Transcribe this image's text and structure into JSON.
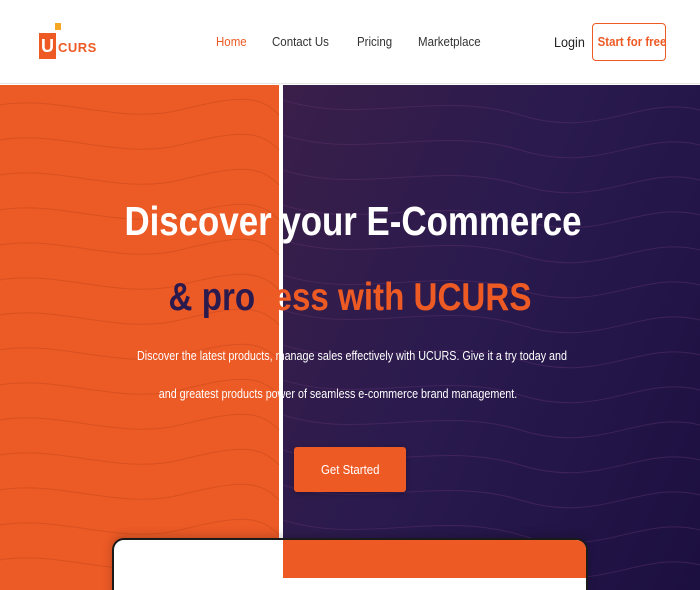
{
  "brand": {
    "logo_letter": "U",
    "logo_text": "CURS",
    "accent_color": "#ee5a24"
  },
  "nav": {
    "links": [
      {
        "label": "Home",
        "active": true
      },
      {
        "label": "Contact Us",
        "active": false
      },
      {
        "label": "Pricing",
        "active": false
      },
      {
        "label": "Marketplace",
        "active": false
      }
    ],
    "login_label": "Login",
    "start_label": "Start for free"
  },
  "hero": {
    "title_line_1": "Discover your E-Commerce",
    "title_line_2_prefix": "& pro",
    "title_line_2_rest": "cess with UCURS",
    "text_line_1": "Discover the latest products, manage sales effectively with UCURS. Give it a try today and",
    "text_line_2": "and greatest products power of seamless e-commerce brand management.",
    "cta_label": "Get Started",
    "left_color": "#ec5a26",
    "right_color": "#2a1a4e"
  }
}
